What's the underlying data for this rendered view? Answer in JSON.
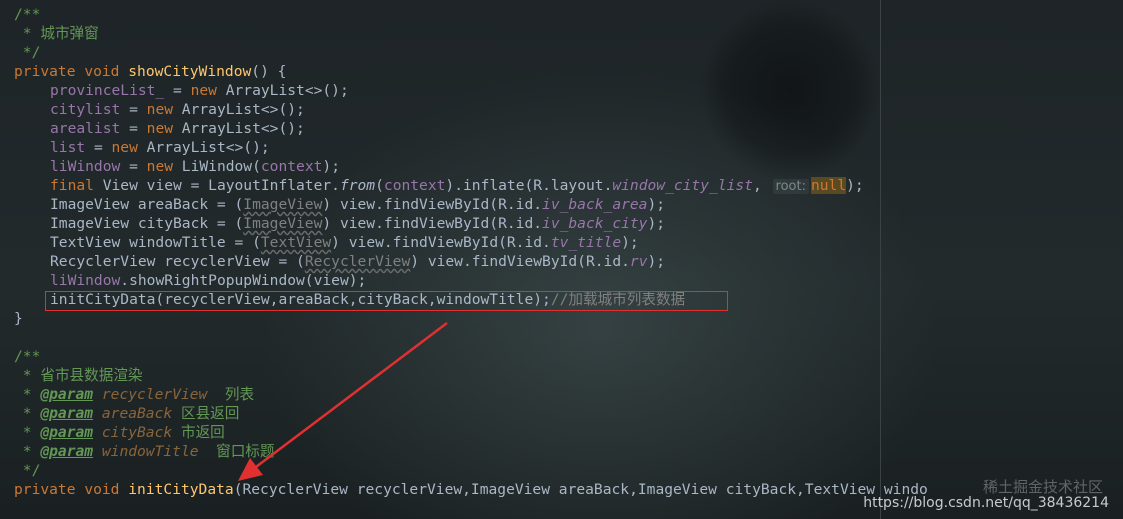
{
  "editor": {
    "lines": {
      "l1": "/**",
      "l2_prefix": " * ",
      "l2_text": "城市弹窗",
      "l3": " */",
      "l4_kw1": "private",
      "l4_kw2": "void",
      "l4_fn": "showCityWindow",
      "l4_rest": "() {",
      "l5_field": "provinceList_",
      "l5_eq": " = ",
      "l5_new": "new",
      "l5_rest": " ArrayList<>();",
      "l6_field": "citylist",
      "l6_eq": " = ",
      "l6_new": "new",
      "l6_rest": " ArrayList<>();",
      "l7_field": "arealist",
      "l7_eq": " = ",
      "l7_new": "new",
      "l7_rest": " ArrayList<>();",
      "l8_field": "list",
      "l8_eq": " = ",
      "l8_new": "new",
      "l8_rest": " ArrayList<>();",
      "l9_field": "liWindow",
      "l9_eq": " = ",
      "l9_new": "new",
      "l9_mid": " LiWindow(",
      "l9_arg": "context",
      "l9_end": ");",
      "l10_kw": "final",
      "l10_a": " View view = LayoutInflater.",
      "l10_from": "from",
      "l10_b": "(",
      "l10_ctx": "context",
      "l10_c": ").inflate(R.layout.",
      "l10_res": "window_city_list",
      "l10_d": ", ",
      "l10_hint": "root:",
      "l10_null": "null",
      "l10_end": ");",
      "l11_a": "ImageView areaBack = (",
      "l11_cast": "ImageView",
      "l11_b": ") view.findViewById(R.id.",
      "l11_id": "iv_back_area",
      "l11_end": ");",
      "l12_a": "ImageView cityBack = (",
      "l12_cast": "ImageView",
      "l12_b": ") view.findViewById(R.id.",
      "l12_id": "iv_back_city",
      "l12_end": ");",
      "l13_a": "TextView windowTitle = (",
      "l13_cast": "TextView",
      "l13_b": ") view.findViewById(R.id.",
      "l13_id": "tv_title",
      "l13_end": ");",
      "l14_a": "RecyclerView recyclerView = (",
      "l14_cast": "RecyclerView",
      "l14_b": ") view.findViewById(R.id.",
      "l14_id": "rv",
      "l14_end": ");",
      "l15_field": "liWindow",
      "l15_rest": ".showRightPopupWindow(view);",
      "l16_code": "initCityData(recyclerView,areaBack,cityBack,windowTitle);",
      "l16_comment": "//加载城市列表数据",
      "l17": "}",
      "l18": "",
      "l19": "/**",
      "l20_prefix": " * ",
      "l20_text": "省市县数据渲染",
      "l21_prefix": " * ",
      "l21_tag": "@param",
      "l21_param": "recyclerView",
      "l21_desc": "  列表",
      "l22_prefix": " * ",
      "l22_tag": "@param",
      "l22_param": "areaBack",
      "l22_desc": "区县返回",
      "l23_prefix": " * ",
      "l23_tag": "@param",
      "l23_param": "cityBack",
      "l23_desc": "市返回",
      "l24_prefix": " * ",
      "l24_tag": "@param",
      "l24_param": "windowTitle",
      "l24_desc": "  窗口标题",
      "l25": " */",
      "l26_kw1": "private",
      "l26_kw2": "void",
      "l26_fn": "initCityData",
      "l26_rest": "(RecyclerView recyclerView,ImageView areaBack,ImageView cityBack,TextView windo"
    }
  },
  "watermark": {
    "text": "https://blog.csdn.net/qq_38436214",
    "overlay": "稀土掘金技术社区"
  },
  "colors": {
    "annotation_box": "#e03030",
    "annotation_arrow": "#e03030"
  }
}
